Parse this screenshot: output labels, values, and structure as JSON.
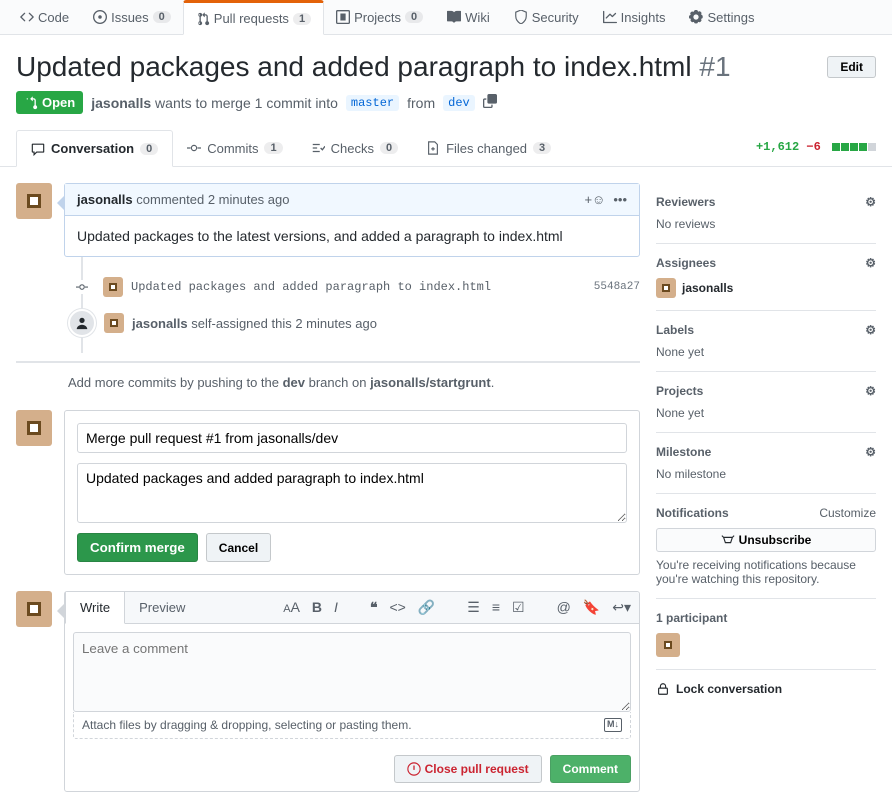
{
  "repo_tabs": [
    {
      "icon": "code",
      "label": "Code"
    },
    {
      "icon": "issue",
      "label": "Issues",
      "count": "0"
    },
    {
      "icon": "pr",
      "label": "Pull requests",
      "count": "1",
      "selected": true
    },
    {
      "icon": "project",
      "label": "Projects",
      "count": "0"
    },
    {
      "icon": "wiki",
      "label": "Wiki"
    },
    {
      "icon": "shield",
      "label": "Security"
    },
    {
      "icon": "graph",
      "label": "Insights"
    },
    {
      "icon": "gear",
      "label": "Settings"
    }
  ],
  "title": "Updated packages and added paragraph to index.html",
  "pr_number": "#1",
  "edit_btn": "Edit",
  "state": "Open",
  "merge_sentence": {
    "user": "jasonalls",
    "middle": "wants to merge 1 commit into",
    "base": "master",
    "from": "from",
    "head": "dev"
  },
  "sub_tabs": {
    "conversation": {
      "label": "Conversation",
      "count": "0"
    },
    "commits": {
      "label": "Commits",
      "count": "1"
    },
    "checks": {
      "label": "Checks",
      "count": "0"
    },
    "files": {
      "label": "Files changed",
      "count": "3"
    }
  },
  "diffstat": {
    "add": "+1,612",
    "del": "−6"
  },
  "first_comment": {
    "author": "jasonalls",
    "action": "commented",
    "time": "2 minutes ago",
    "body": "Updated packages to the latest versions, and added a paragraph to index.html"
  },
  "commit": {
    "message": "Updated packages and added paragraph to index.html",
    "sha": "5548a27"
  },
  "self_assign": {
    "user": "jasonalls",
    "text": "self-assigned this 2 minutes ago"
  },
  "push_hint": {
    "prefix": "Add more commits by pushing to the ",
    "branch": "dev",
    "mid": " branch on ",
    "repo": "jasonalls/startgrunt",
    "suffix": "."
  },
  "merge": {
    "title": "Merge pull request #1 from jasonalls/dev",
    "body": "Updated packages and added paragraph to index.html",
    "confirm": "Confirm merge",
    "cancel": "Cancel"
  },
  "write": {
    "write_tab": "Write",
    "preview_tab": "Preview",
    "placeholder": "Leave a comment",
    "attach": "Attach files by dragging & dropping, selecting or pasting them.",
    "close": "Close pull request",
    "comment": "Comment"
  },
  "sidebar": {
    "reviewers": {
      "title": "Reviewers",
      "body": "No reviews"
    },
    "assignees": {
      "title": "Assignees",
      "user": "jasonalls"
    },
    "labels": {
      "title": "Labels",
      "body": "None yet"
    },
    "projects": {
      "title": "Projects",
      "body": "None yet"
    },
    "milestone": {
      "title": "Milestone",
      "body": "No milestone"
    },
    "notifications": {
      "title": "Notifications",
      "customize": "Customize",
      "unsubscribe": "Unsubscribe",
      "reason": "You're receiving notifications because you're watching this repository."
    },
    "participants": {
      "title": "1 participant"
    },
    "lock": "Lock conversation"
  }
}
